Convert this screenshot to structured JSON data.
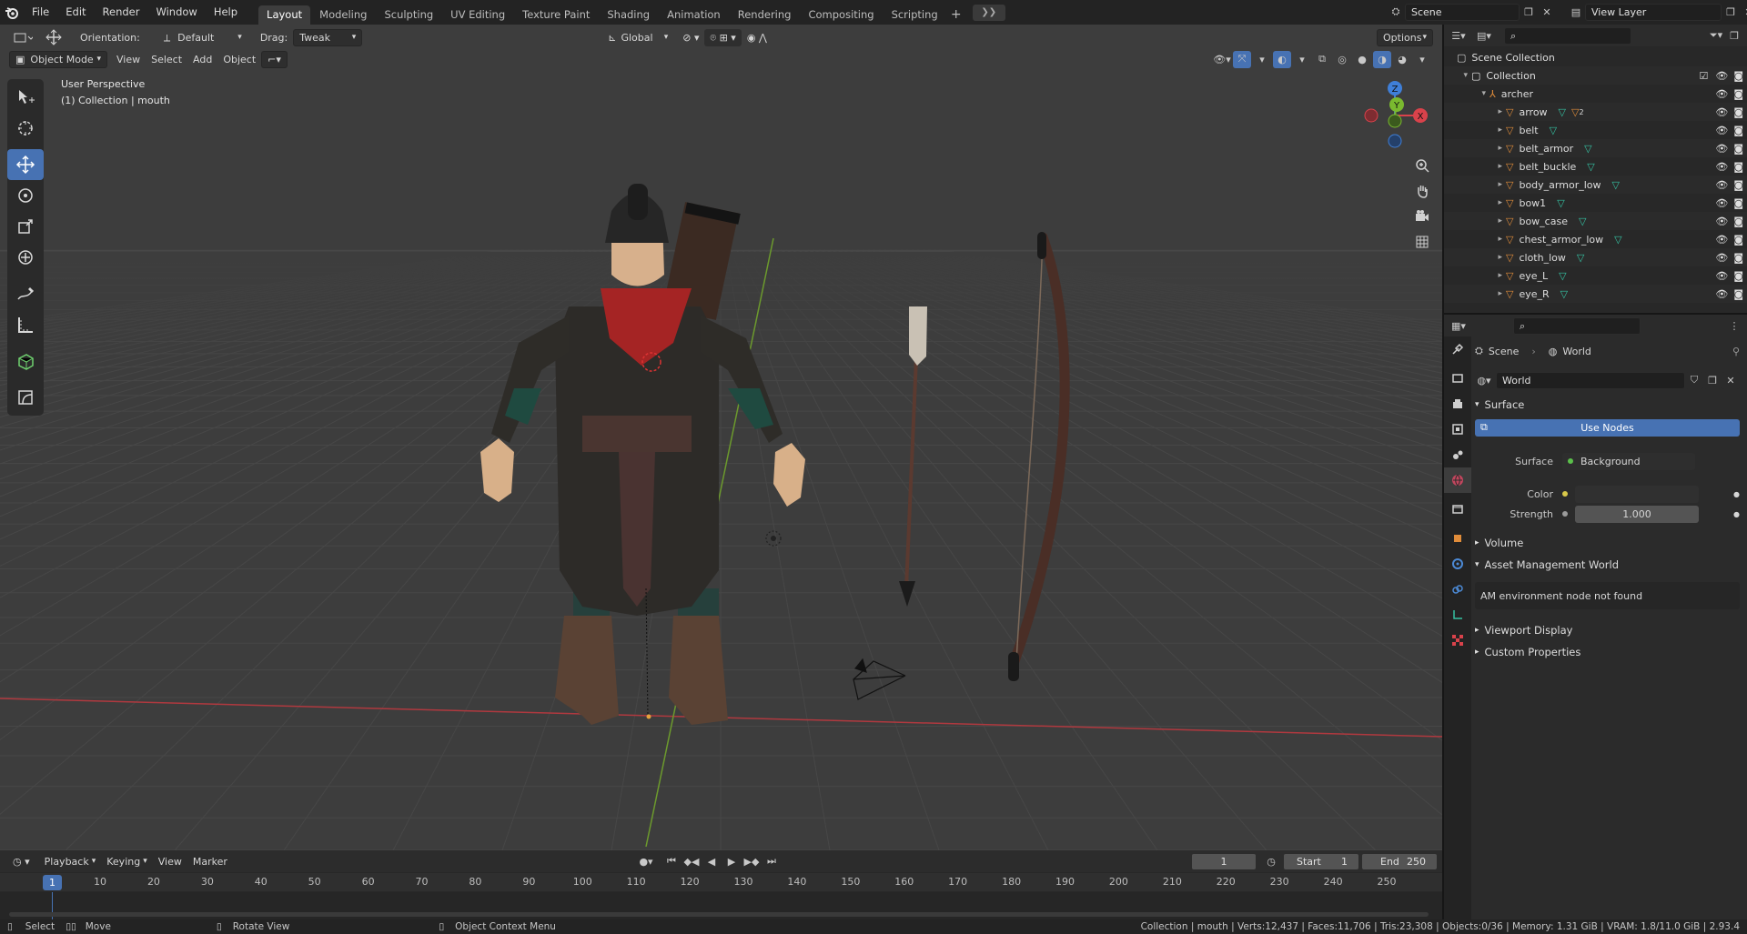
{
  "menubar": {
    "items": [
      "File",
      "Edit",
      "Render",
      "Window",
      "Help"
    ],
    "tabs": [
      "Layout",
      "Modeling",
      "Sculpting",
      "UV Editing",
      "Texture Paint",
      "Shading",
      "Animation",
      "Rendering",
      "Compositing",
      "Scripting"
    ],
    "active_tab": "Layout",
    "scene": "Scene",
    "view_layer": "View Layer"
  },
  "viewport": {
    "orientation_label": "Orientation:",
    "orientation_value": "Default",
    "drag_label": "Drag:",
    "drag_value": "Tweak",
    "transform_space": "Global",
    "options_label": "Options",
    "mode": "Object Mode",
    "menus": [
      "View",
      "Select",
      "Add",
      "Object"
    ],
    "perspective_text": "User Perspective",
    "context_text": "(1) Collection | mouth",
    "gizmo_axes": [
      "Z",
      "Y",
      "X"
    ]
  },
  "timeline": {
    "menus": [
      "Playback",
      "Keying",
      "View",
      "Marker"
    ],
    "current_frame": "1",
    "start_label": "Start",
    "start": "1",
    "end_label": "End",
    "end": "250",
    "ticks": [
      "1",
      "10",
      "20",
      "30",
      "40",
      "50",
      "60",
      "70",
      "80",
      "90",
      "100",
      "110",
      "120",
      "130",
      "140",
      "150",
      "160",
      "170",
      "180",
      "190",
      "200",
      "210",
      "220",
      "230",
      "240",
      "250"
    ]
  },
  "statusbar": {
    "select": "Select",
    "move": "Move",
    "rotate": "Rotate View",
    "context_menu": "Object Context Menu",
    "stats": "Collection | mouth | Verts:12,437 | Faces:11,706 | Tris:23,308 | Objects:0/36 | Memory: 1.31 GiB | VRAM: 1.8/11.0 GiB | 2.93.4"
  },
  "outliner": {
    "scene_collection": "Scene Collection",
    "collection": "Collection",
    "armature": "archer",
    "objects": [
      "arrow",
      "belt",
      "belt_armor",
      "belt_buckle",
      "body_armor_low",
      "bow1",
      "bow_case",
      "chest_armor_low",
      "cloth_low",
      "eye_L",
      "eye_R"
    ],
    "arrow_badge": "2"
  },
  "properties": {
    "breadcrumb_scene": "Scene",
    "breadcrumb_world": "World",
    "world_name": "World",
    "surface_panel": "Surface",
    "use_nodes": "Use Nodes",
    "surface_label": "Surface",
    "surface_value": "Background",
    "color_label": "Color",
    "strength_label": "Strength",
    "strength_value": "1.000",
    "volume_panel": "Volume",
    "asset_panel": "Asset Management World",
    "asset_message": "AM environment node not found",
    "viewport_display_panel": "Viewport Display",
    "custom_props_panel": "Custom Properties"
  },
  "colors": {
    "accent": "#4772b3",
    "mesh_icon": "#e08c3a",
    "modifier_icon": "#35c1a2",
    "x_axis": "#d9424b",
    "y_axis": "#7ab92f",
    "z_axis": "#3f7fd8"
  }
}
